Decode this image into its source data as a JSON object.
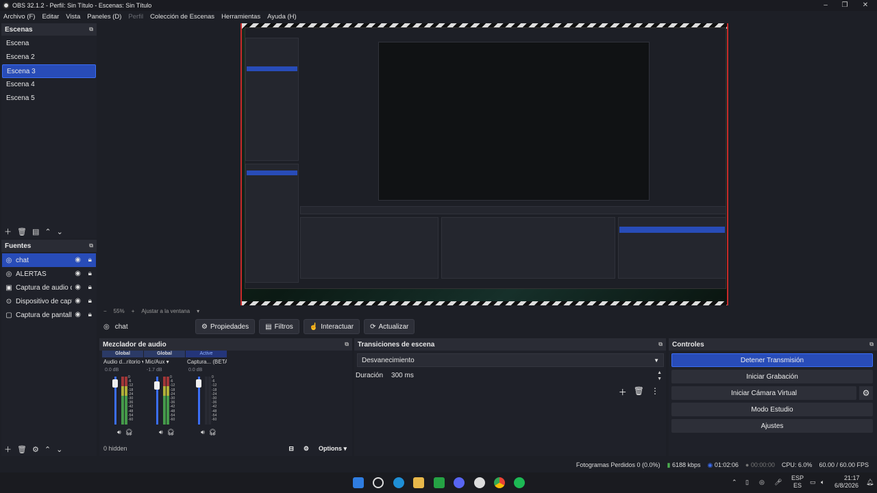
{
  "window": {
    "title": "OBS 32.1.2 - Perfil: Sin Título - Escenas: Sin Título"
  },
  "menu": [
    "Archivo (F)",
    "Editar",
    "Vista",
    "Paneles (D)",
    "Perfil",
    "Colección de Escenas",
    "Herramientas",
    "Ayuda (H)"
  ],
  "scenes": {
    "title": "Escenas",
    "items": [
      "Escena",
      "Escena 2",
      "Escena 3",
      "Escena 4",
      "Escena 5"
    ],
    "active_index": 2
  },
  "sources": {
    "title": "Fuentes",
    "items": [
      {
        "name": "chat",
        "icon": "globe-icon",
        "active": true
      },
      {
        "name": "ALERTAS",
        "icon": "globe-icon",
        "active": false
      },
      {
        "name": "Captura de audio de",
        "icon": "monitor-audio-icon",
        "active": false
      },
      {
        "name": "Dispositivo de capt",
        "icon": "camera-icon",
        "active": false
      },
      {
        "name": "Captura de pantalla",
        "icon": "display-icon",
        "active": false
      }
    ]
  },
  "preview": {
    "zoom": "55%",
    "fit_label": "Ajustar a la ventana"
  },
  "context_bar": {
    "source_name": "chat",
    "buttons": {
      "properties": "Propiedades",
      "filters": "Filtros",
      "interact": "Interactuar",
      "refresh": "Actualizar"
    }
  },
  "mixer": {
    "title": "Mezclador de audio",
    "channels": [
      {
        "tag": "Global",
        "name": "Audio d...ritorio",
        "db": "0.0 dB"
      },
      {
        "tag": "Global",
        "name": "Mic/Aux",
        "db": "-1.7 dB"
      },
      {
        "tag": "Active",
        "name": "Captura... (BETA)",
        "db": "0.0 dB"
      }
    ],
    "scale": [
      "0",
      "-6",
      "-12",
      "-18",
      "-24",
      "-30",
      "-36",
      "-42",
      "-48",
      "-54",
      "-60"
    ],
    "hidden": "0 hidden",
    "options": "Options"
  },
  "transitions": {
    "title": "Transiciones de escena",
    "selected": "Desvanecimiento",
    "duration_label": "Duración",
    "duration_value": "300 ms"
  },
  "controls": {
    "title": "Controles",
    "stop_stream": "Detener Transmisión",
    "start_recording": "Iniciar Grabación",
    "start_virtualcam": "Iniciar Cámara Virtual",
    "studio_mode": "Modo Estudio",
    "settings": "Ajustes"
  },
  "status": {
    "dropped": "Fotogramas Perdidos 0 (0.0%)",
    "bitrate": "6188 kbps",
    "stream_time": "01:02:06",
    "rec_time": "00:00:00",
    "cpu": "CPU: 6.0%",
    "fps": "60.00 / 60.00 FPS"
  },
  "taskbar": {
    "lang": "ESP",
    "region": "ES",
    "time": "21:17",
    "date": "6/8/2026"
  },
  "colors": {
    "accent": "#284cb8",
    "accent_border": "#3b6ef5",
    "live": "#c92a2a",
    "bg": "#1d1f26"
  }
}
